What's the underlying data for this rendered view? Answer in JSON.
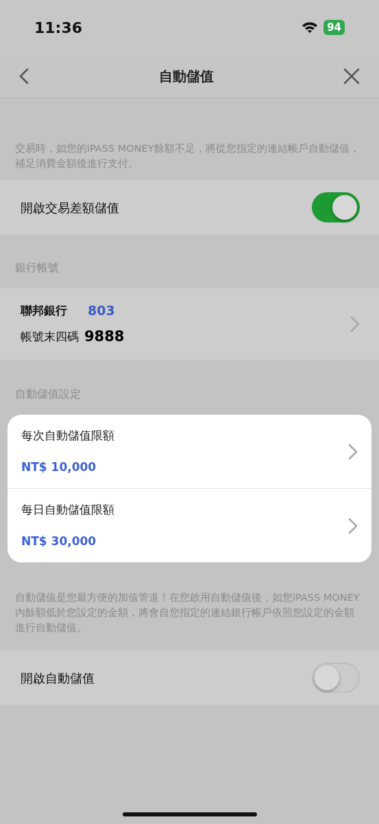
{
  "status_bar": {
    "time": "11:36",
    "battery": "94"
  },
  "nav": {
    "title": "自動儲值"
  },
  "intro": "交易時，如您的iPASS MONEY餘額不足，將從您指定的連結帳戶自動儲值，補足消費金額後進行支付。",
  "transaction_toggle": {
    "label": "開啟交易差額儲值",
    "on": true
  },
  "bank_section": {
    "header": "銀行帳號",
    "bank_name": "聯邦銀行",
    "bank_code": "803",
    "account_label": "帳號末四碼",
    "account_last4": "9888"
  },
  "limits_section": {
    "header": "自動儲值設定",
    "highlighted": true,
    "items": [
      {
        "label": "每次自動儲值限額",
        "value": "NT$ 10,000"
      },
      {
        "label": "每日自動儲值限額",
        "value": "NT$ 30,000"
      }
    ]
  },
  "auto_note": "自動儲值是您最方便的加值管道！在您啟用自動儲值後，如您iPASS MONEY內餘額低於您設定的金額，將會自您指定的連結銀行帳戶依照您設定的金額進行自動儲值。",
  "auto_toggle": {
    "label": "開啟自動儲值",
    "on": false
  }
}
